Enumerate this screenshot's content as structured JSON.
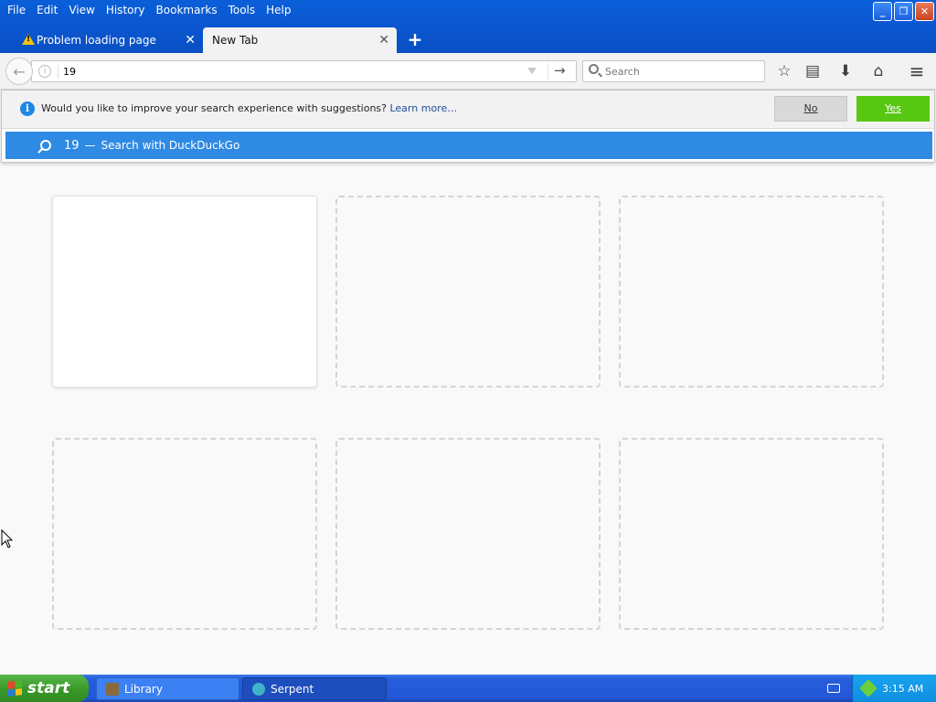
{
  "menu": [
    "File",
    "Edit",
    "View",
    "History",
    "Bookmarks",
    "Tools",
    "Help"
  ],
  "window_controls": {
    "minimize": "_",
    "restore": "❐",
    "close": "✕"
  },
  "tabs": [
    {
      "label": "Problem loading page",
      "icon": "warning-icon",
      "active": false
    },
    {
      "label": "New Tab",
      "active": true
    }
  ],
  "new_tab": "+",
  "nav": {
    "back": "←",
    "url_value": "19",
    "go": "→",
    "search_placeholder": "Search",
    "bookmark_star": "☆",
    "reading_list": "▤",
    "downloads": "⬇",
    "home": "⌂",
    "menu": "≡"
  },
  "optin": {
    "icon": "i",
    "message": "Would you like to improve your search experience with suggestions?",
    "learn_more": "Learn more…",
    "no_label": "No",
    "yes_label": "Yes"
  },
  "suggestion": {
    "term": "19",
    "separator": "—",
    "engine_text": "Search with DuckDuckGo"
  },
  "tiles": [
    {
      "state": "thumbnail"
    },
    {
      "state": "empty"
    },
    {
      "state": "empty"
    },
    {
      "state": "empty"
    },
    {
      "state": "empty"
    },
    {
      "state": "empty"
    }
  ],
  "taskbar": {
    "start_label": "start",
    "items": [
      {
        "label": "Library",
        "active": true
      },
      {
        "label": "Serpent",
        "active": false
      }
    ],
    "clock": "3:15 AM"
  },
  "colors": {
    "accent_blue": "#2f8ae3",
    "yes_green": "#57c713",
    "xp_blue": "#0a58d2"
  }
}
